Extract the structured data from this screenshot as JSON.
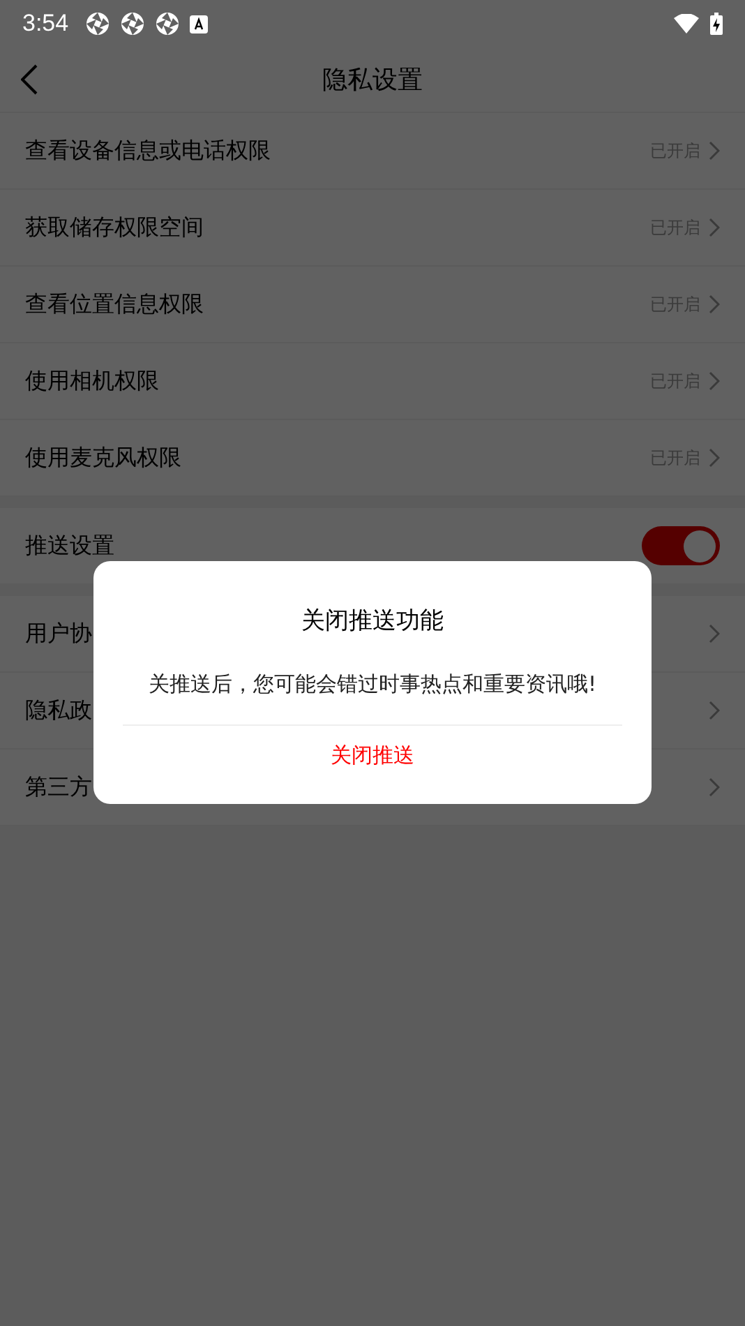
{
  "status_bar": {
    "time": "3:54"
  },
  "header": {
    "title": "隐私设置"
  },
  "permissions": [
    {
      "label": "查看设备信息或电话权限",
      "status": "已开启"
    },
    {
      "label": "获取储存权限空间",
      "status": "已开启"
    },
    {
      "label": "查看位置信息权限",
      "status": "已开启"
    },
    {
      "label": "使用相机权限",
      "status": "已开启"
    },
    {
      "label": "使用麦克风权限",
      "status": "已开启"
    }
  ],
  "push": {
    "label": "推送设置",
    "on": true
  },
  "links": [
    {
      "label": "用户协"
    },
    {
      "label": "隐私政"
    },
    {
      "label": "第三方"
    }
  ],
  "dialog": {
    "title": "关闭推送功能",
    "message": "关推送后，您可能会错过时事热点和重要资讯哦!",
    "button": "关闭推送"
  }
}
